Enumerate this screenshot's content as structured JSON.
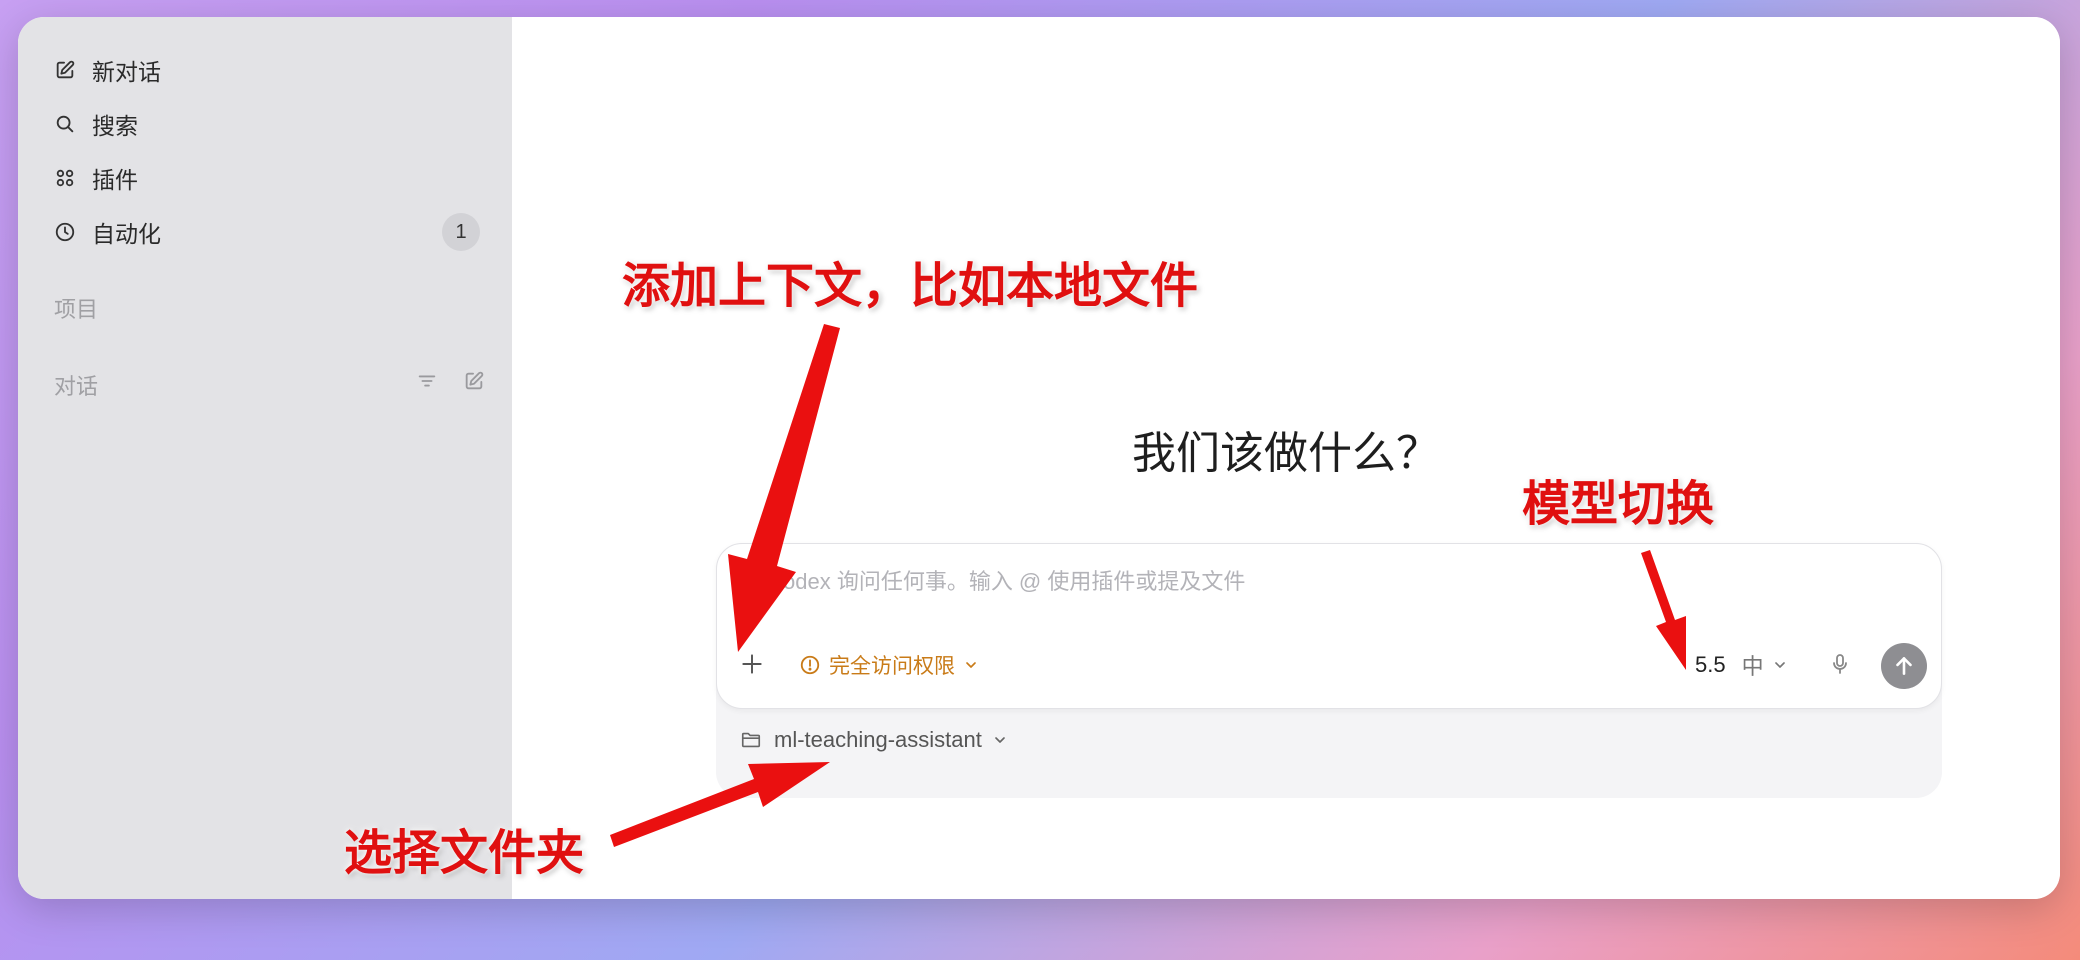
{
  "sidebar": {
    "items": [
      {
        "label": "新对话",
        "icon": "compose-icon"
      },
      {
        "label": "搜索",
        "icon": "search-icon"
      },
      {
        "label": "插件",
        "icon": "plugins-grid-icon"
      },
      {
        "label": "自动化",
        "icon": "clock-icon",
        "badge": "1"
      }
    ],
    "projects_label": "项目",
    "conversations_label": "对话"
  },
  "main": {
    "headline": "我们该做什么？",
    "composer": {
      "placeholder": "向 Codex 询问任何事。输入 @ 使用插件或提及文件",
      "access_label": "完全访问权限",
      "model_label": "5.5",
      "effort_label": "中"
    },
    "folder_label": "ml-teaching-assistant"
  },
  "annotations": {
    "add_context": "添加上下文，比如本地文件",
    "model_switch": "模型切换",
    "select_folder": "选择文件夹"
  },
  "colors": {
    "annotation_red": "#e01010",
    "access_orange": "#c97b18",
    "send_button_gray": "#8e8e92"
  }
}
